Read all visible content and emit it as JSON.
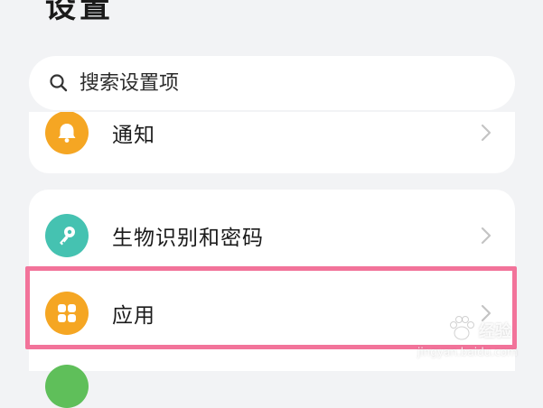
{
  "header": {
    "title": "设置"
  },
  "search": {
    "placeholder": "搜索设置项"
  },
  "settings": {
    "notify": {
      "label": "通知",
      "icon": "bell-icon",
      "color": "#f5a623"
    },
    "items": [
      {
        "label": "生物识别和密码",
        "icon": "key-icon",
        "color": "#45c2b1"
      },
      {
        "label": "应用",
        "icon": "apps-grid-icon",
        "color": "#f5a623"
      }
    ],
    "next_item_color": "#5fbf5a"
  },
  "highlight": {
    "color": "#f2739a"
  },
  "watermark": {
    "brand": "经验",
    "url": "jingyan.baidu.com"
  }
}
